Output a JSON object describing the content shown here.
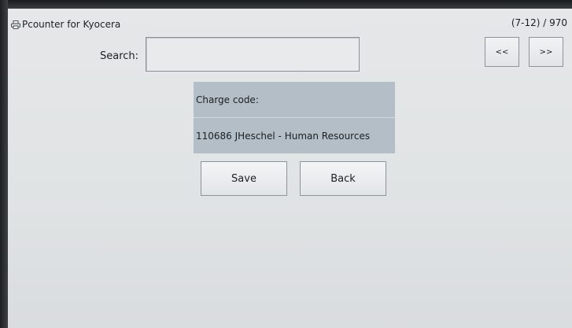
{
  "app": {
    "title": "Pcounter for Kyocera",
    "icon": "printer-icon",
    "page_counter": "(7-12) / 970"
  },
  "search": {
    "label": "Search:",
    "value": ""
  },
  "pagination": {
    "prev_label": "<<",
    "next_label": ">>"
  },
  "charge": {
    "label": "Charge code:",
    "value": "110686 JHeschel - Human Resources"
  },
  "actions": {
    "save_label": "Save",
    "back_label": "Back"
  }
}
